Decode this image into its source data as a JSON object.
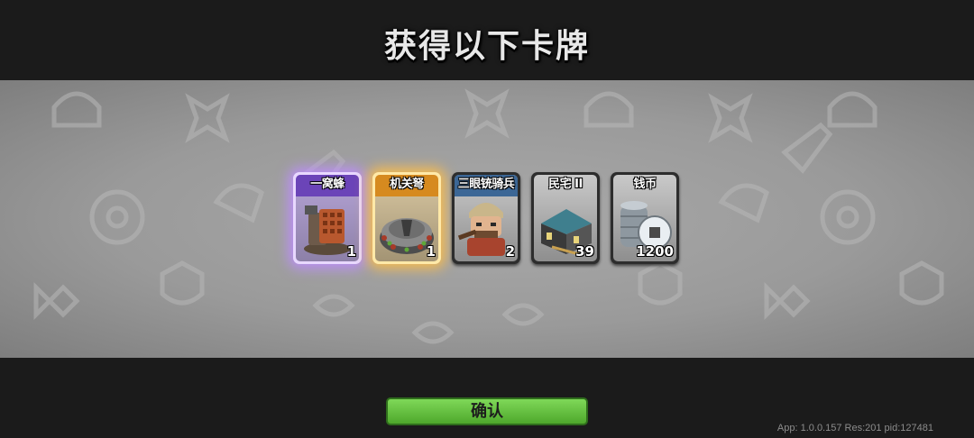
{
  "title": "获得以下卡牌",
  "cards": [
    {
      "name": "一窝蜂",
      "count": "1",
      "rarity": "epic",
      "icon": "hive-tower-icon"
    },
    {
      "name": "机关弩",
      "count": "1",
      "rarity": "legendary",
      "icon": "crossbow-tower-icon"
    },
    {
      "name": "三眼铳骑兵",
      "count": "2",
      "rarity": "rare",
      "icon": "gunner-cavalry-icon"
    },
    {
      "name": "民宅 II",
      "count": "39",
      "rarity": "common",
      "icon": "house-icon"
    },
    {
      "name": "钱币",
      "count": "1200",
      "rarity": "currency",
      "icon": "coin-icon"
    }
  ],
  "confirm_label": "确认",
  "version_text": "App: 1.0.0.157 Res:201 pid:127481",
  "colors": {
    "epic": "#6b44b8",
    "legendary": "#d68a1f",
    "rare": "#3c6796",
    "confirm": "#5cb838"
  }
}
